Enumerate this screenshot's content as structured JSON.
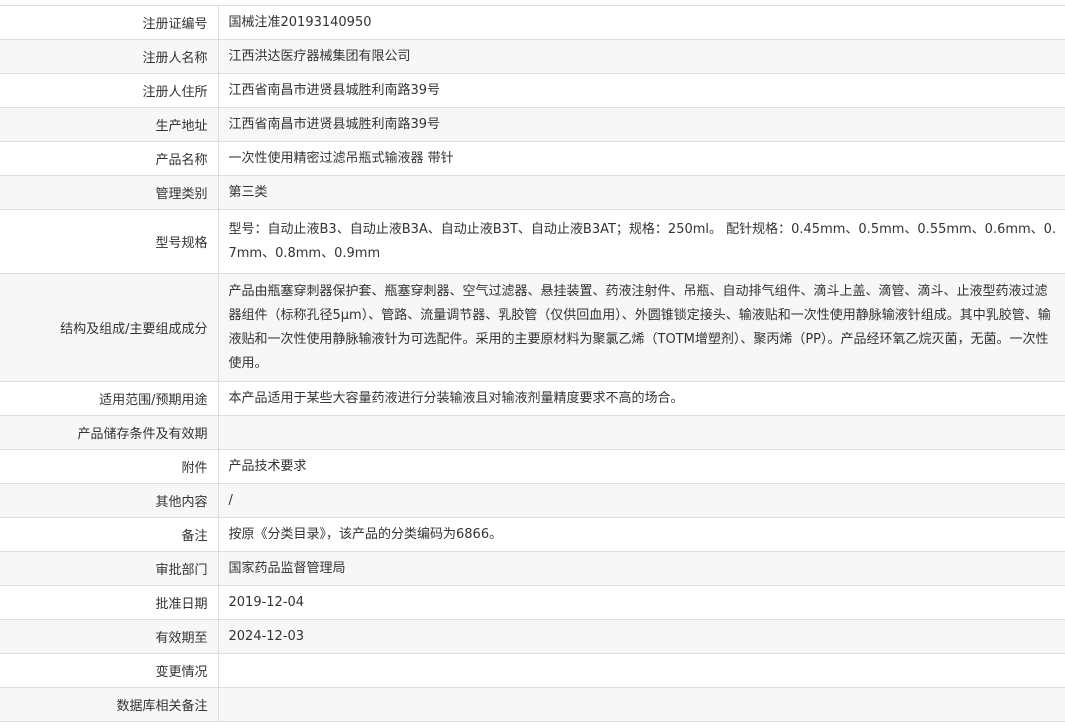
{
  "rows": [
    {
      "label": "注册证编号",
      "value": "国械注准20193140950"
    },
    {
      "label": "注册人名称",
      "value": "江西洪达医疗器械集团有限公司"
    },
    {
      "label": "注册人住所",
      "value": "江西省南昌市进贤县城胜利南路39号"
    },
    {
      "label": "生产地址",
      "value": "江西省南昌市进贤县城胜利南路39号"
    },
    {
      "label": "产品名称",
      "value": "一次性使用精密过滤吊瓶式输液器 带针"
    },
    {
      "label": "管理类别",
      "value": "第三类"
    },
    {
      "label": "型号规格",
      "value": "型号：自动止液B3、自动止液B3A、自动止液B3T、自动止液B3AT；规格：250ml。 配针规格：0.45mm、0.5mm、0.55mm、0.6mm、0.7mm、0.8mm、0.9mm"
    },
    {
      "label": "结构及组成/主要组成成分",
      "value": "产品由瓶塞穿刺器保护套、瓶塞穿刺器、空气过滤器、悬挂装置、药液注射件、吊瓶、自动排气组件、滴斗上盖、滴管、滴斗、止液型药液过滤器组件（标称孔径5μm）、管路、流量调节器、乳胶管（仅供回血用）、外圆锥锁定接头、输液贴和一次性使用静脉输液针组成。其中乳胶管、输液贴和一次性使用静脉输液针为可选配件。采用的主要原材料为聚氯乙烯（TOTM增塑剂）、聚丙烯（PP）。产品经环氧乙烷灭菌，无菌。一次性使用。"
    },
    {
      "label": "适用范围/预期用途",
      "value": "本产品适用于某些大容量药液进行分装输液且对输液剂量精度要求不高的场合。"
    },
    {
      "label": "产品储存条件及有效期",
      "value": ""
    },
    {
      "label": "附件",
      "value": "产品技术要求"
    },
    {
      "label": "其他内容",
      "value": "/"
    },
    {
      "label": "备注",
      "value": "按原《分类目录》，该产品的分类编码为6866。"
    },
    {
      "label": "审批部门",
      "value": "国家药品监督管理局"
    },
    {
      "label": "批准日期",
      "value": "2019-12-04"
    },
    {
      "label": "有效期至",
      "value": "2024-12-03"
    },
    {
      "label": "变更情况",
      "value": ""
    },
    {
      "label": "数据库相关备注",
      "value": ""
    }
  ]
}
